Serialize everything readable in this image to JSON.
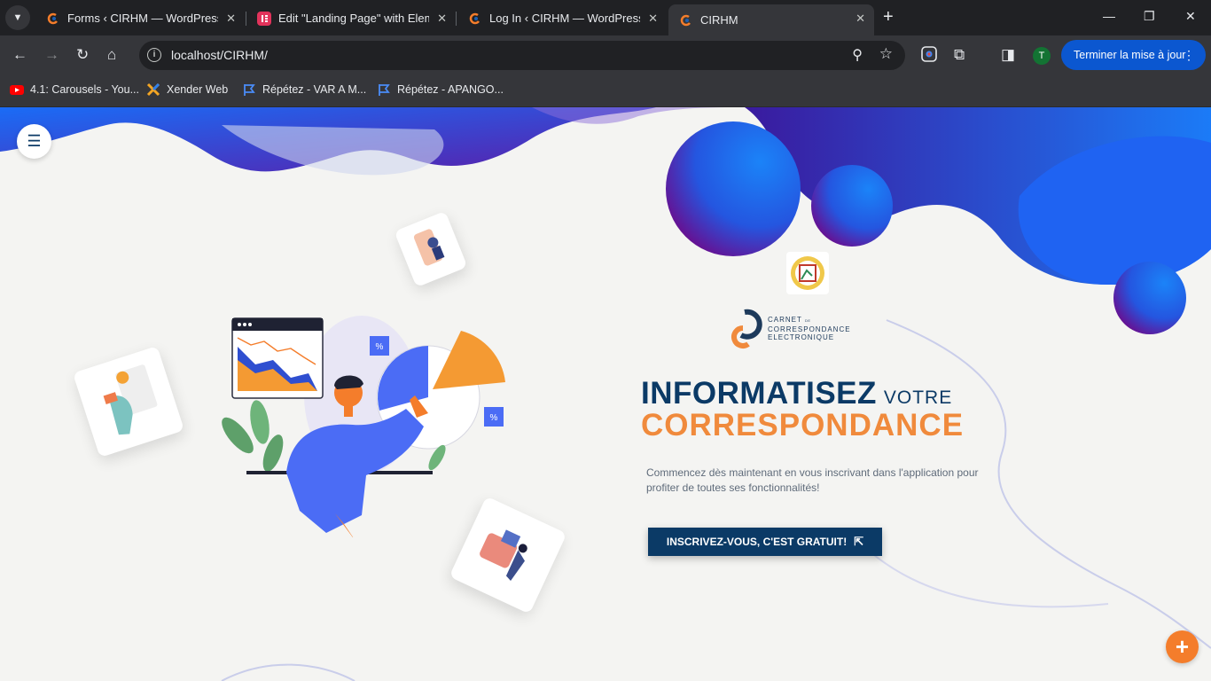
{
  "browser": {
    "tabs": [
      {
        "title": "Forms ‹ CIRHM — WordPress",
        "active": false
      },
      {
        "title": "Edit \"Landing Page\" with Elementor",
        "active": false
      },
      {
        "title": "Log In ‹ CIRHM — WordPress",
        "active": false
      },
      {
        "title": "CIRHM",
        "active": true
      }
    ],
    "url": "localhost/CIRHM/",
    "profile_initial": "T",
    "update_button": "Terminer la mise à jour",
    "bookmarks": [
      {
        "label": "4.1: Carousels - You..."
      },
      {
        "label": "Xender Web"
      },
      {
        "label": "Répétez - VAR A M..."
      },
      {
        "label": "Répétez - APANGO..."
      }
    ]
  },
  "hero": {
    "logo_line1": "CARNET",
    "logo_small": "DE",
    "logo_line2": "CORRESPONDANCE",
    "logo_line3": "ELECTRONIQUE",
    "title_bold": "INFORMATISEZ",
    "title_light": "VOTRE",
    "title_accent": "CORRESPONDANCE",
    "description": "Commencez dès maintenant en vous inscrivant dans l'application pour profiter de toutes ses fonctionnalités!",
    "cta_label": "INSCRIVEZ-VOUS, C'EST GRATUIT!"
  },
  "colors": {
    "navy": "#0b3a66",
    "orange": "#f08a3c",
    "blue": "#2f6df6",
    "purple": "#6a1fa0"
  },
  "icons": {
    "menu": "hamburger-icon",
    "cta": "cursor-pointer-icon",
    "fab": "plus-icon"
  }
}
